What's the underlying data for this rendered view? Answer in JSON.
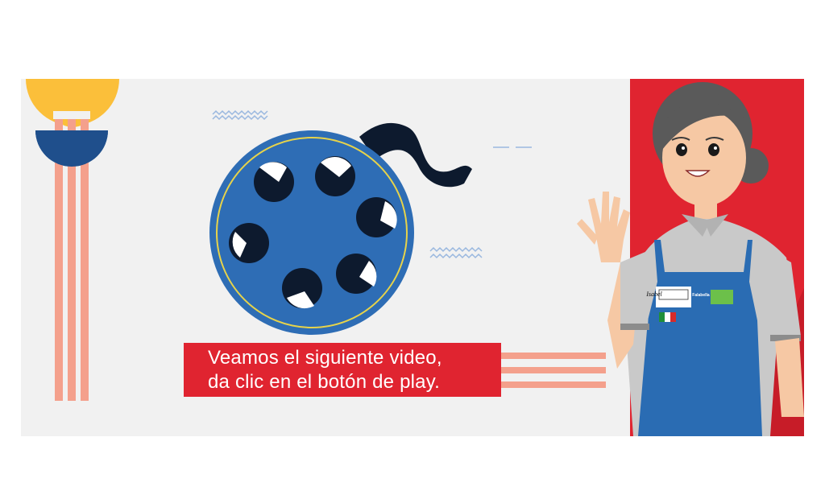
{
  "caption": {
    "line1": "Veamos el siguiente video,",
    "line2": "da clic en el botón de play."
  },
  "badge": {
    "name": "Isabel",
    "brand": "Falabella"
  },
  "colors": {
    "background": "#f1f1f1",
    "accent_red": "#e02430",
    "reel_blue": "#2e6db5",
    "sun_yellow": "#fbbf3a",
    "stripe_salmon": "#f4a08c",
    "navy": "#0d1a2e",
    "apron_blue": "#2a6cb3",
    "brand_green": "#6cc04a"
  },
  "icons": {
    "film_reel": "film-reel-icon",
    "flag": "mexico-flag-icon"
  }
}
